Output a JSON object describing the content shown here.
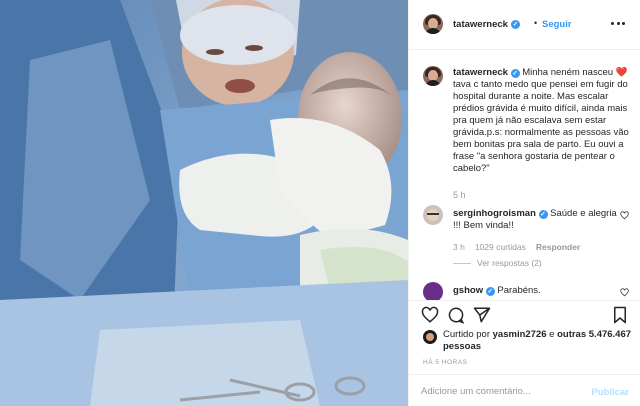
{
  "post": {
    "username": "tatawerneck",
    "follow_label": "Seguir",
    "separator": "•"
  },
  "caption": {
    "username": "tatawerneck",
    "text": "Minha neném nasceu ❤️ tava c tanto medo que pensei em fugir do hospital durante a noite. Mas escalar prédios grávida é muito difícil, ainda mais pra quem já não escalava sem estar grávida.p.s: normalmente as pessoas vão bem bonitas pra sala de parto. Eu ouvi a frase \"a senhora gostaria de pentear o cabelo?\"",
    "time": "5 h"
  },
  "comments": [
    {
      "username": "serginhogroisman",
      "text": "Saúde e alegria !!! Bem vinda!!",
      "time": "3 h",
      "likes": "1029 curtidas",
      "reply_label": "Responder",
      "view_replies": "Ver respostas (2)"
    },
    {
      "username": "gshow",
      "text": "Parabéns."
    }
  ],
  "likes": {
    "prefix": "Curtido por",
    "user": "yasmin2726",
    "middle": "e",
    "others": "outras 5.476.467 pessoas"
  },
  "time_ago": "HÁ 5 HORAS",
  "add_comment": {
    "placeholder": "Adicione um comentário...",
    "post_label": "Publicar"
  },
  "colors": {
    "accent": "#3897f0",
    "post_disabled": "#b2dffc",
    "muted": "#999999"
  },
  "icons": [
    "more-icon",
    "verified-icon",
    "heart-icon",
    "comment-icon",
    "share-icon",
    "bookmark-icon"
  ]
}
